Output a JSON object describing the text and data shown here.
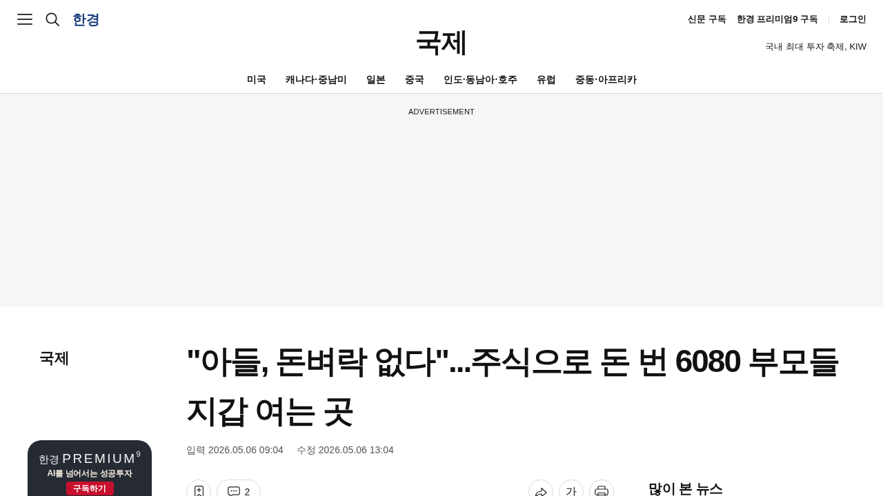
{
  "header": {
    "logo": "한경",
    "links": [
      "신문 구독",
      "한경 프리미엄9 구독"
    ],
    "login": "로그인",
    "section_title": "국제",
    "promo": "국내 최대 투자 축제, KIW"
  },
  "nav": [
    "미국",
    "캐나다·중남미",
    "일본",
    "중국",
    "인도·동남아·호주",
    "유럽",
    "중동·아프리카"
  ],
  "ad": {
    "label": "ADVERTISEMENT"
  },
  "sidebar": {
    "section": "국제",
    "promo_card": {
      "logo_prefix": "한경",
      "logo": "PREMIUM$^{9}$",
      "tagline": "AI를 넘어서는 성공투자",
      "button": "구독하기"
    }
  },
  "article": {
    "headline": "\"아들, 돈벼락 없다\"...주식으로 돈 번 6080 부모들 지갑 여는 곳",
    "published": "입력 2026.05.06 09:04",
    "modified": "수정 2026.05.06 13:04",
    "actions": [
      {
        "kind": "bookmark"
      },
      {
        "kind": "comments",
        "count": "2"
      }
    ],
    "tools": [
      {
        "kind": "share"
      },
      {
        "kind": "font_size",
        "label": "가"
      },
      {
        "kind": "print"
      }
    ]
  },
  "most_read": {
    "title": "많이 본 뉴스"
  }
}
